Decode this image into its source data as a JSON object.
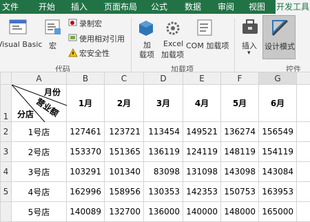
{
  "tabs": [
    "文件",
    "开始",
    "插入",
    "页面布局",
    "公式",
    "数据",
    "审阅",
    "视图",
    "开发工具"
  ],
  "ribbon": {
    "code": {
      "visual_basic": "Visual Basic",
      "macro": "宏",
      "record_macro": "录制宏",
      "relative_ref": "使用相对引用",
      "macro_security": "宏安全性",
      "group": "代码"
    },
    "addins": {
      "addin_line1": "加",
      "addin_line2": "载项",
      "excel_line1": "Excel",
      "excel_line2": "加载项",
      "com": "COM 加载项",
      "group": "加载项"
    },
    "controls": {
      "insert": "插入",
      "design_mode": "设计模式",
      "group": "控件"
    }
  },
  "sheet": {
    "columns": [
      "A",
      "B",
      "C",
      "D",
      "E",
      "F",
      "G"
    ],
    "rows": [
      "1",
      "2",
      "3",
      "4",
      "5"
    ],
    "header": {
      "month": "月份",
      "amount": "营业额",
      "store": "分店",
      "months": [
        "1月",
        "2月",
        "3月",
        "4月",
        "5月",
        "6月"
      ]
    },
    "data": [
      {
        "store": "1号店",
        "values": [
          "127461",
          "123721",
          "113454",
          "149521",
          "136274",
          "156549"
        ]
      },
      {
        "store": "2号店",
        "values": [
          "153370",
          "151365",
          "136119",
          "124119",
          "148119",
          "154119"
        ]
      },
      {
        "store": "3号店",
        "values": [
          "103291",
          "101340",
          "83098",
          "131098",
          "143098",
          "143084"
        ]
      },
      {
        "store": "4号店",
        "values": [
          "162996",
          "158956",
          "130353",
          "142353",
          "150753",
          "163953"
        ]
      }
    ],
    "partial_row": {
      "store": "5号店",
      "values": [
        "140089",
        "132700",
        "136000",
        "140000",
        "148000",
        "165000"
      ]
    }
  }
}
